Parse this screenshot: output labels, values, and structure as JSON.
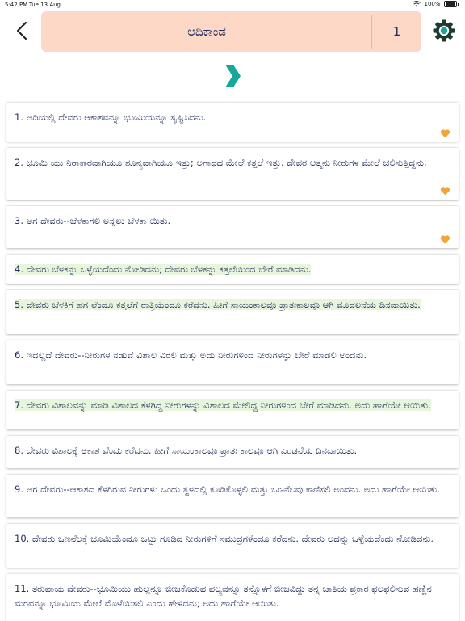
{
  "status": {
    "time": "5:42 PM",
    "date": "Tue 13 Aug",
    "battery": "100%"
  },
  "header": {
    "book": "ಆದಿಕಾಂಡ",
    "chapter": "1"
  },
  "colors": {
    "header_bg": "#fdd8c6",
    "accent": "#16a89a",
    "text": "#1f2b5a",
    "highlight": "#e7f5dd",
    "heart": "#f2a33a"
  },
  "icons": {
    "back": "chevron-left-icon",
    "settings": "gear-icon",
    "next": "chevron-right-icon",
    "favorite": "heart-icon"
  },
  "verses": [
    {
      "text": "1. ಆದಿಯಲ್ಲಿ ದೇವರು ಆಕಾಶವನ್ನೂ ಭೂಮಿಯನ್ನೂ ಸೃಷ್ಟಿಸಿದನು.",
      "highlighted": false,
      "favorite": true
    },
    {
      "text": "2. ಭೂಮಿ ಯು ನಿರಾಕಾರವಾಗಿಯೂ ಶೂನ್ಯವಾಗಿಯೂ ಇತ್ತು; ಅಗಾಧದ ಮೇಲೆ ಕತ್ತಲೆ ಇತ್ತು. ದೇವರ ಆತ್ಮನು ನೀರುಗಳ ಮೇಲೆ ಚಲಿಸುತ್ತಿದ್ದನು.",
      "highlighted": false,
      "favorite": true
    },
    {
      "text": "3. ಆಗ ದೇವರು--ಬೆಳಕಾಗಲಿ ಅನ್ನಲು ಬೆಳಕಾ ಯಿತು.",
      "highlighted": false,
      "favorite": true
    },
    {
      "text": "4. ದೇವರು ಬೆಳಕನ್ನು ಒಳ್ಳೆಯದೆಂದು ನೋಡಿದನು; ದೇವರು ಬೆಳಕನ್ನು ಕತ್ತಲೆಯಿಂದ ಬೇರೆ ಮಾಡಿದನು.",
      "highlighted": true,
      "favorite": false
    },
    {
      "text": "5. ದೇವರು ಬೆಳಕಿಗೆ ಹಗ ಲೆಂದೂ ಕತ್ತಲೆಗೆ ರಾತ್ರಿಯೆಂದೂ ಕರೆದನು. ಹೀಗೆ ಸಾಯಂಕಾಲವೂ ಪ್ರಾತಃಕಾಲವೂ ಆಗಿ ಮೊದಲನೆಯ ದಿನವಾಯಿತು.",
      "highlighted": true,
      "favorite": false
    },
    {
      "text": "6. ಇದಲ್ಲದೆ ದೇವರು--ನೀರುಗಳ ನಡುವೆ ವಿಶಾಲ ವಿರಲಿ ಮತ್ತು ಅದು ನೀರುಗಳಿಂದ ನೀರುಗಳನ್ನು ಬೇರೆ ಮಾಡಲಿ ಅಂದನು.",
      "highlighted": false,
      "favorite": false
    },
    {
      "text": "7. ದೇವರು ವಿಶಾಲವನ್ನು ಮಾಡಿ ವಿಶಾಲದ ಕೆಳಗಿದ್ದ ನೀರುಗಳನ್ನು ವಿಶಾಲದ ಮೇಲಿದ್ದ ನೀರುಗಳಿಂದ ಬೇರೆ ಮಾಡಿದನು. ಅದು ಹಾಗೆಯೇ ಆಯಿತು.",
      "highlighted": true,
      "favorite": false
    },
    {
      "text": "8. ದೇವರು ವಿಶಾಲಕ್ಕೆ ಆಕಾಶ ವೆಂದು ಕರೆದನು. ಹೀಗೆ ಸಾಯಂಕಾಲವೂ ಪ್ರಾತಃ ಕಾಲವೂ ಆಗಿ ಎರಡನೆಯ ದಿನವಾಯಿತು.",
      "highlighted": false,
      "favorite": false
    },
    {
      "text": "9. ಆಗ ದೇವರು--ಆಕಾಶದ ಕೆಳಗಿರುವ ನೀರುಗಳು ಒಂದು ಸ್ಥಳದಲ್ಲಿ ಕೂಡಿಕೊಳ್ಳಲಿ ಮತ್ತು ಒಣನೆಲವು ಕಾಣಿಸಲಿ ಅಂದನು. ಅದು ಹಾಗೆಯೇ ಆಯಿತು.",
      "highlighted": false,
      "favorite": false
    },
    {
      "text": "10. ದೇವರು ಒಣನೆಲಕ್ಕೆ ಭೂಮಿಯೆಂದೂ ಒಟ್ಟು ಗೂಡಿದ ನೀರುಗಳಿಗೆ ಸಮುದ್ರಗಳೆಂದೂ ಕರೆದನು. ದೇವರು ಅದನ್ನು ಒಳ್ಳೆಯದೆಂದು ನೋಡಿದನು.",
      "highlighted": false,
      "favorite": false
    },
    {
      "text": "11. ತರುವಾಯ ದೇವರು--ಭೂಮಿಯು ಹುಲ್ಲನ್ನೂ ಬೀಜಕೊಡುವ ಪಲ್ಯವನ್ನೂ ತನ್ನೊಳಗೆ ಬೀಜವಿದ್ದು ತನ್ನ ಜಾತಿಯ ಪ್ರಕಾರ ಫಲಫಲಿಸುವ ಹಣ್ಣಿನ ಮರವನ್ನೂ ಭೂಮಿಯ ಮೇಲೆ ಮೊಳೆಯಿಸಲಿ ಎಂದು ಹೇಳಿದನು; ಅದು ಹಾಗೆಯೇ ಆಯಿತು.",
      "highlighted": false,
      "favorite": false
    }
  ]
}
